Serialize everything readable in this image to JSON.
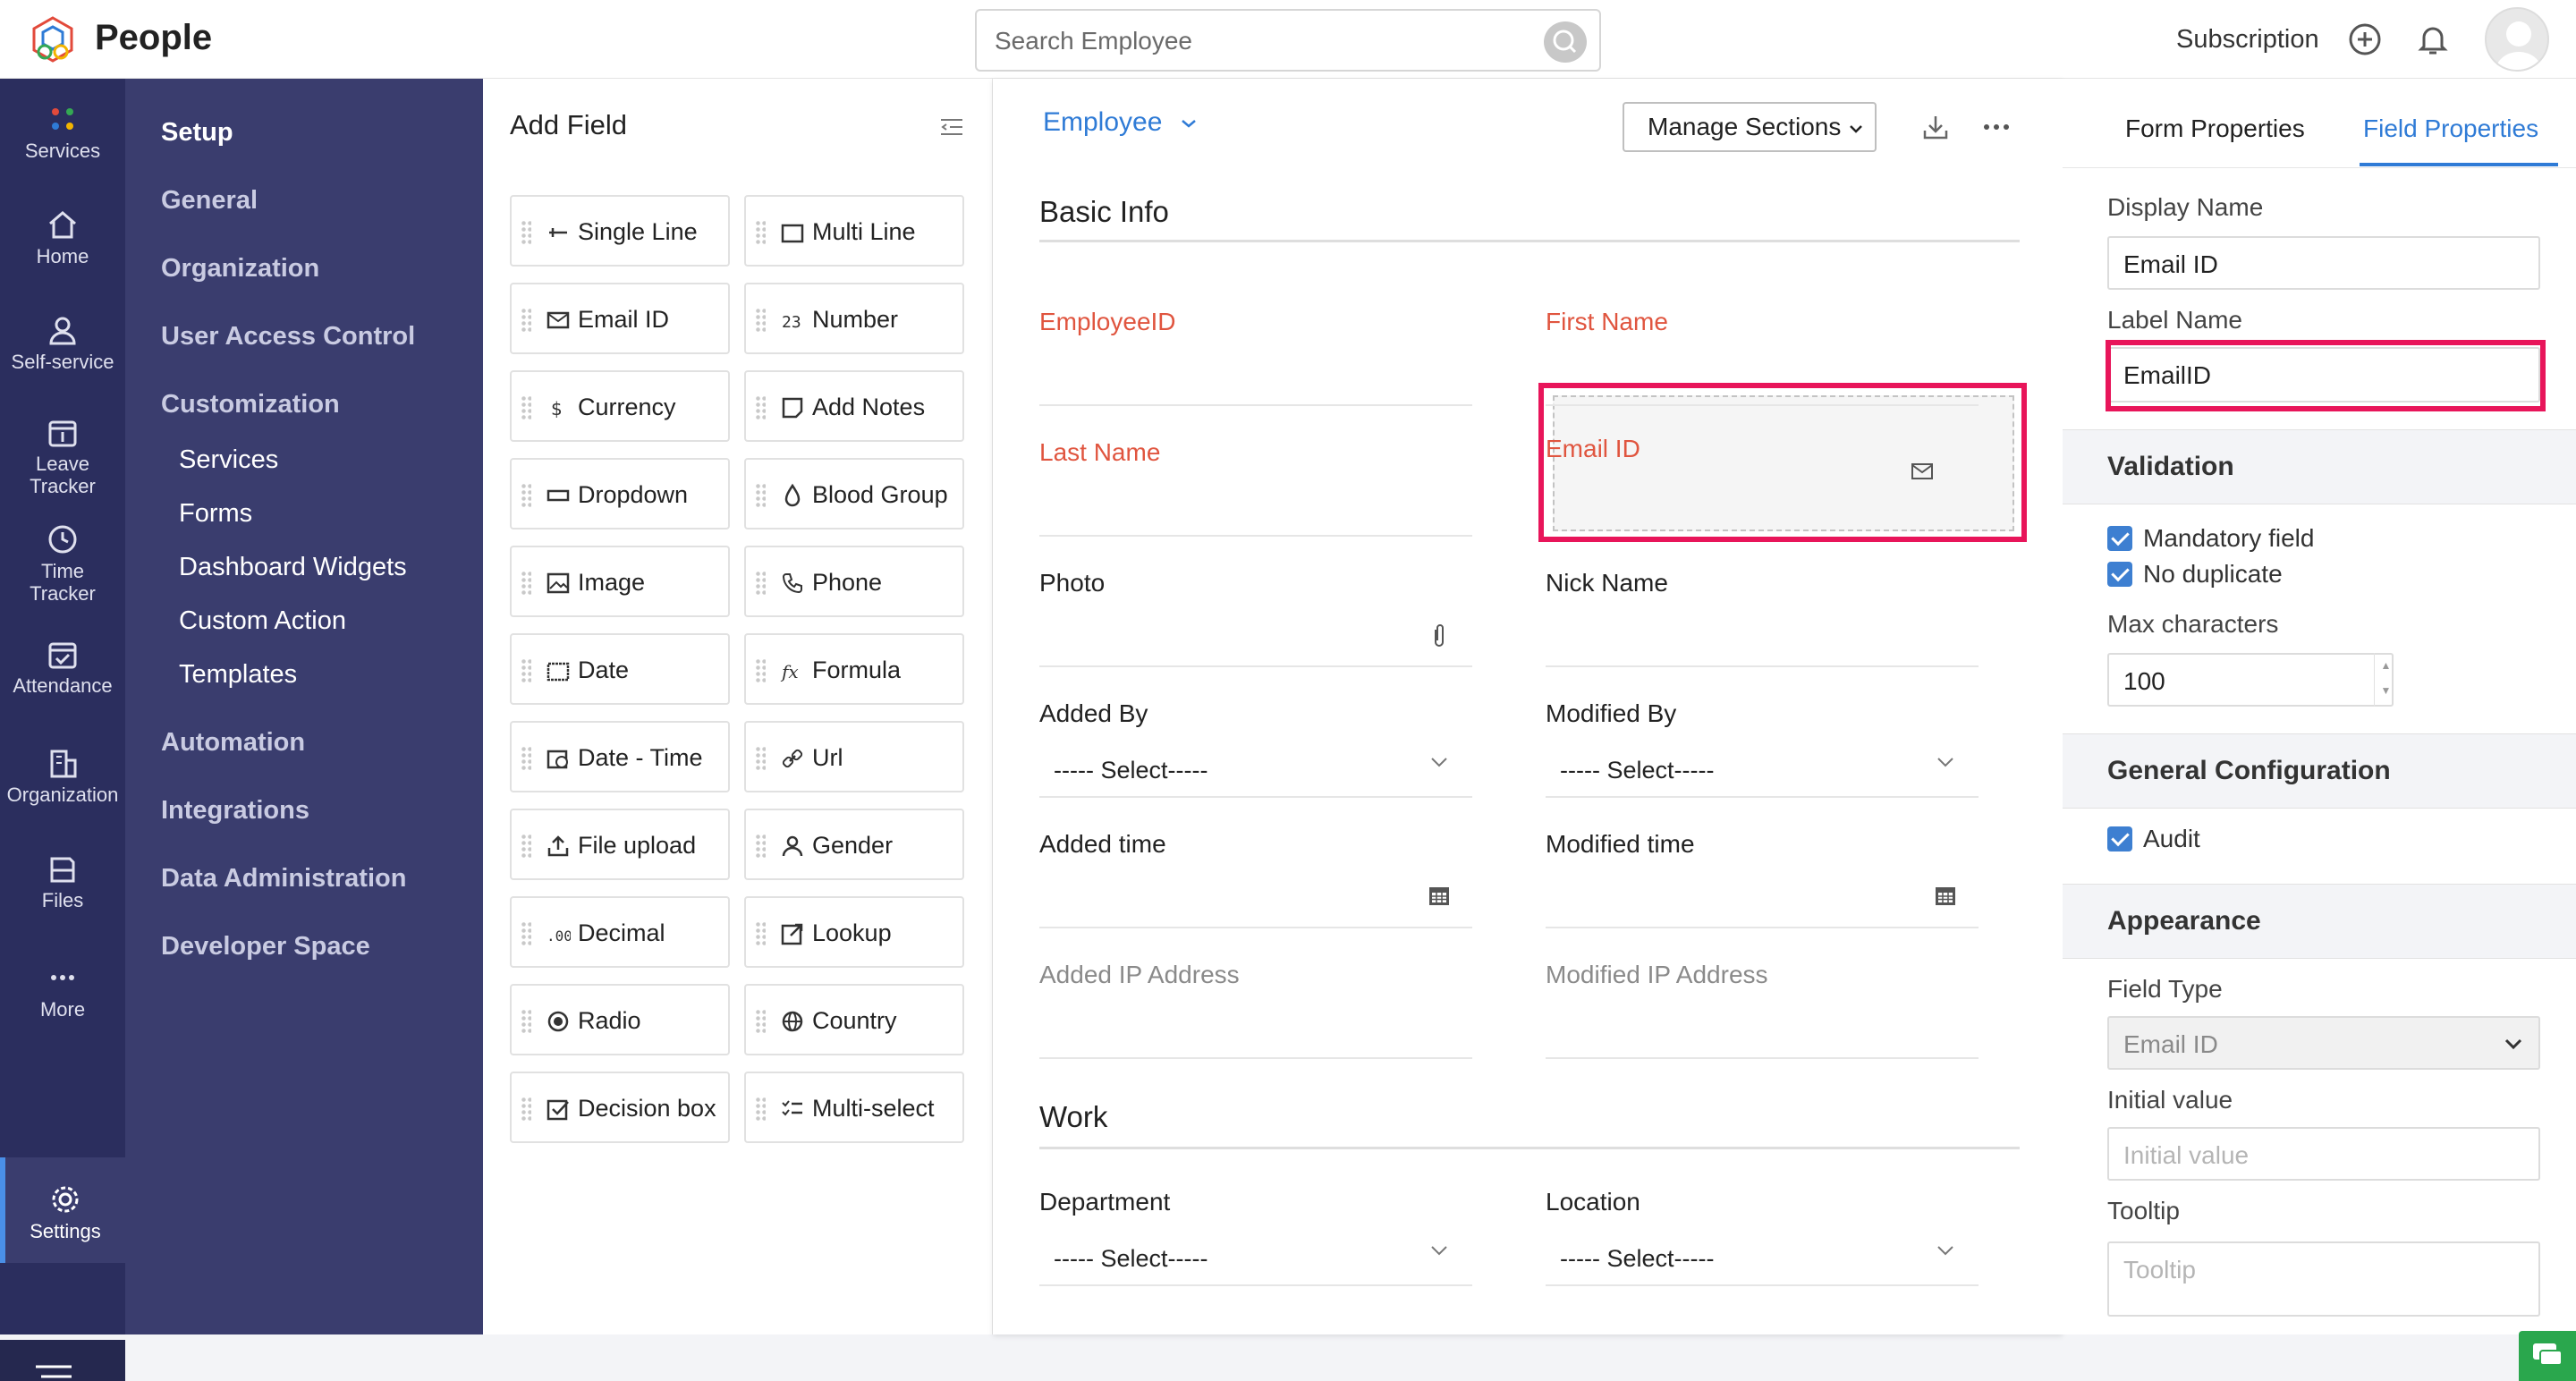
{
  "header": {
    "app_name": "People",
    "search_placeholder": "Search Employee",
    "subscription": "Subscription"
  },
  "rail": {
    "items": [
      {
        "label": "Services",
        "icon": "services-dots-icon"
      },
      {
        "label": "Home",
        "icon": "home-icon"
      },
      {
        "label": "Self-service",
        "icon": "person-icon"
      },
      {
        "label": "Leave",
        "label2": "Tracker",
        "icon": "calendar-icon"
      },
      {
        "label": "Time",
        "label2": "Tracker",
        "icon": "clock-icon"
      },
      {
        "label": "Attendance",
        "icon": "attendance-icon"
      },
      {
        "label": "Organization",
        "icon": "building-icon"
      },
      {
        "label": "Files",
        "icon": "files-icon"
      },
      {
        "label": "More",
        "icon": "more-dots-icon"
      },
      {
        "label": "Settings",
        "icon": "gear-icon"
      }
    ]
  },
  "settings_menu": {
    "items": [
      "Setup",
      "General",
      "Organization",
      "User Access Control",
      "Customization"
    ],
    "customization_sub": [
      "Services",
      "Forms",
      "Dashboard Widgets",
      "Custom Action",
      "Templates"
    ],
    "items_after": [
      "Automation",
      "Integrations",
      "Data Administration",
      "Developer Space"
    ]
  },
  "add_field": {
    "title": "Add Field",
    "fields": [
      [
        "Single Line",
        "Multi Line"
      ],
      [
        "Email ID",
        "Number"
      ],
      [
        "Currency",
        "Add Notes"
      ],
      [
        "Dropdown",
        "Blood Group"
      ],
      [
        "Image",
        "Phone"
      ],
      [
        "Date",
        "Formula"
      ],
      [
        "Date - Time",
        "Url"
      ],
      [
        "File upload",
        "Gender"
      ],
      [
        "Decimal",
        "Lookup"
      ],
      [
        "Radio",
        "Country"
      ],
      [
        "Decision box",
        "Multi-select"
      ]
    ]
  },
  "form": {
    "form_name": "Employee",
    "manage_sections": "Manage Sections",
    "sections": [
      {
        "title": "Basic Info",
        "fields": [
          {
            "label": "EmployeeID"
          },
          {
            "label": "First Name"
          },
          {
            "label": "Last Name"
          },
          {
            "label": "Email ID"
          },
          {
            "label": "Photo"
          },
          {
            "label": "Nick Name"
          },
          {
            "label": "Added By",
            "value": "----- Select-----"
          },
          {
            "label": "Modified By",
            "value": "----- Select-----"
          },
          {
            "label": "Added time"
          },
          {
            "label": "Modified time"
          },
          {
            "label": "Added IP Address"
          },
          {
            "label": "Modified IP Address"
          }
        ]
      },
      {
        "title": "Work",
        "fields": [
          {
            "label": "Department",
            "value": "----- Select-----"
          },
          {
            "label": "Location",
            "value": "----- Select-----"
          }
        ]
      }
    ]
  },
  "properties": {
    "tabs": [
      "Form Properties",
      "Field Properties"
    ],
    "active_tab": "Field Properties",
    "display_name_label": "Display Name",
    "display_name": "Email ID",
    "label_name_label": "Label Name",
    "label_name": "EmailID",
    "validation": {
      "title": "Validation",
      "mandatory": "Mandatory field",
      "no_duplicate": "No duplicate",
      "max_chars_label": "Max characters",
      "max_chars": "100"
    },
    "general": {
      "title": "General Configuration",
      "audit": "Audit"
    },
    "appearance": {
      "title": "Appearance",
      "field_type_label": "Field Type",
      "field_type": "Email ID",
      "initial_value_label": "Initial value",
      "initial_value_placeholder": "Initial value",
      "tooltip_label": "Tooltip",
      "tooltip_placeholder": "Tooltip"
    }
  },
  "colors": {
    "accent": "#2f7bd6",
    "highlight": "#e8155a",
    "required_label": "#e0553f",
    "rail": "#2b2e5e",
    "settings_menu": "#3a3d6e"
  }
}
